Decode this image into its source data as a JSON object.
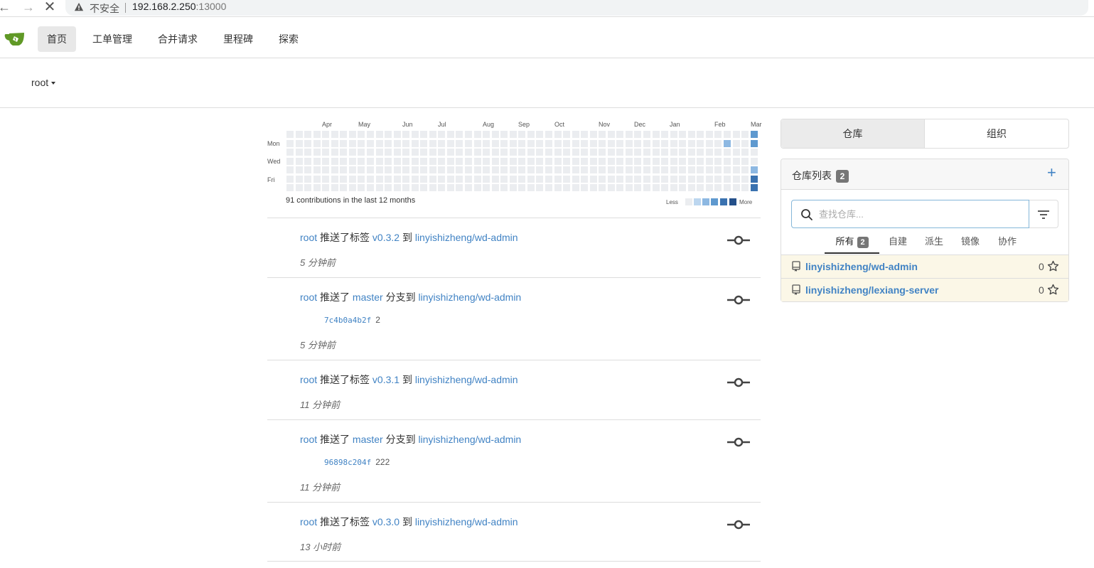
{
  "browser": {
    "insecure_label": "不安全",
    "url_host": "192.168.2.250",
    "url_port": ":13000",
    "back_icon": "arrow-left",
    "forward_icon": "arrow-right",
    "stop_icon": "close"
  },
  "nav": {
    "items": [
      {
        "label": "首页",
        "active": true
      },
      {
        "label": "工单管理"
      },
      {
        "label": "合并请求"
      },
      {
        "label": "里程碑"
      },
      {
        "label": "探索"
      }
    ]
  },
  "context": {
    "user": "root"
  },
  "heatmap": {
    "months": [
      "Apr",
      "May",
      "Jun",
      "Jul",
      "Aug",
      "Sep",
      "Oct",
      "Nov",
      "Dec",
      "Jan",
      "Feb",
      "Mar"
    ],
    "weekdays": [
      "Mon",
      "Wed",
      "Fri"
    ],
    "caption": "91 contributions in the last 12 months",
    "less": "Less",
    "more": "More",
    "colors": [
      "#ebedf0",
      "#bcd6ef",
      "#8db8e2",
      "#5f99cf",
      "#3a72b0",
      "#24508a"
    ]
  },
  "feed": [
    {
      "actor": "root",
      "action": "推送了标签",
      "ref": "v0.3.2",
      "mid": "到",
      "repo": "linyishizheng/wd-admin",
      "time": "5 分钟前"
    },
    {
      "actor": "root",
      "action": "推送了",
      "ref": "master",
      "mid": "分支到",
      "repo": "linyishizheng/wd-admin",
      "sha": "7c4b0a4b2f",
      "msg": "2",
      "time": "5 分钟前"
    },
    {
      "actor": "root",
      "action": "推送了标签",
      "ref": "v0.3.1",
      "mid": "到",
      "repo": "linyishizheng/wd-admin",
      "time": "11 分钟前"
    },
    {
      "actor": "root",
      "action": "推送了",
      "ref": "master",
      "mid": "分支到",
      "repo": "linyishizheng/wd-admin",
      "sha": "96898c204f",
      "msg": "222",
      "time": "11 分钟前"
    },
    {
      "actor": "root",
      "action": "推送了标签",
      "ref": "v0.3.0",
      "mid": "到",
      "repo": "linyishizheng/wd-admin",
      "time": "13 小时前"
    }
  ],
  "panel": {
    "tabs": [
      "仓库",
      "组织"
    ],
    "title": "仓库列表",
    "count": "2",
    "search_placeholder": "查找仓库...",
    "subtabs": [
      {
        "label": "所有",
        "count": "2"
      },
      {
        "label": "自建"
      },
      {
        "label": "派生"
      },
      {
        "label": "镜像"
      },
      {
        "label": "协作"
      }
    ],
    "repos": [
      {
        "name": "linyishizheng/wd-admin",
        "stars": "0"
      },
      {
        "name": "linyishizheng/lexiang-server",
        "stars": "0"
      }
    ]
  }
}
